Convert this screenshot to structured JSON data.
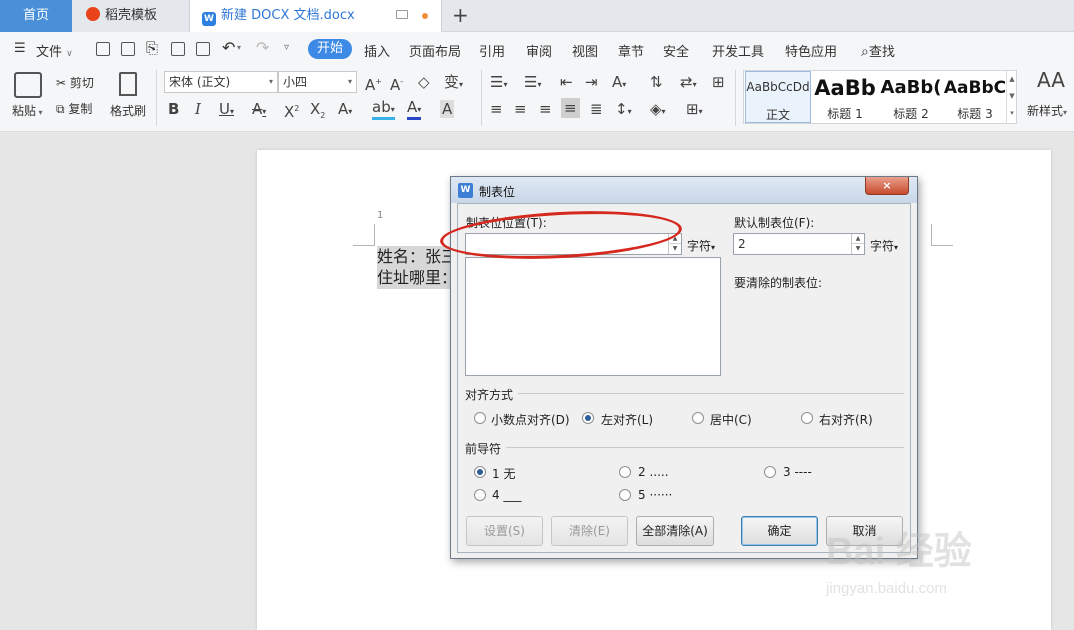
{
  "tabs": {
    "home": "首页",
    "templates": "稻壳模板",
    "document": "新建 DOCX 文档.docx",
    "add": "+"
  },
  "menubar": {
    "file": "文件",
    "items": [
      "开始",
      "插入",
      "页面布局",
      "引用",
      "审阅",
      "视图",
      "章节",
      "安全",
      "开发工具",
      "特色应用"
    ],
    "search": "查找"
  },
  "ribbon": {
    "paste": "粘贴",
    "cut": "剪切",
    "copy": "复制",
    "format_painter": "格式刷",
    "font_name": "宋体 (正文)",
    "font_size": "小四",
    "styles": [
      {
        "sample": "AaBbCcDd",
        "label": "正文"
      },
      {
        "sample": "AaBb",
        "label": "标题 1"
      },
      {
        "sample": "AaBb(",
        "label": "标题 2"
      },
      {
        "sample": "AaBbC",
        "label": "标题 3"
      }
    ],
    "new_style": "新样式"
  },
  "document": {
    "line_number": "1",
    "line1": "姓名：张三",
    "line2": "住址哪里："
  },
  "dialog": {
    "title": "制表位",
    "tab_position_label": "制表位位置(T):",
    "tab_position_value": "",
    "unit1": "字符",
    "default_tab_label": "默认制表位(F):",
    "default_tab_value": "2",
    "unit2": "字符",
    "clear_label": "要清除的制表位:",
    "alignment_label": "对齐方式",
    "alignment_options": [
      "小数点对齐(D)",
      "左对齐(L)",
      "居中(C)",
      "右对齐(R)"
    ],
    "alignment_selected": "左对齐(L)",
    "leader_label": "前导符",
    "leader_options": [
      "1 无",
      "2 .....",
      "3 ----",
      "4 ___",
      "5 ······"
    ],
    "leader_selected": "1 无",
    "buttons": {
      "set": "设置(S)",
      "clear": "清除(E)",
      "clear_all": "全部清除(A)",
      "ok": "确定",
      "cancel": "取消"
    },
    "close": "×"
  },
  "watermark": {
    "brand": "Bai 经验",
    "url": "jingyan.baidu.com"
  },
  "colors": {
    "accent": "#3d8ae6",
    "home_tab": "#4a90d9",
    "annotation": "#d5281e"
  }
}
